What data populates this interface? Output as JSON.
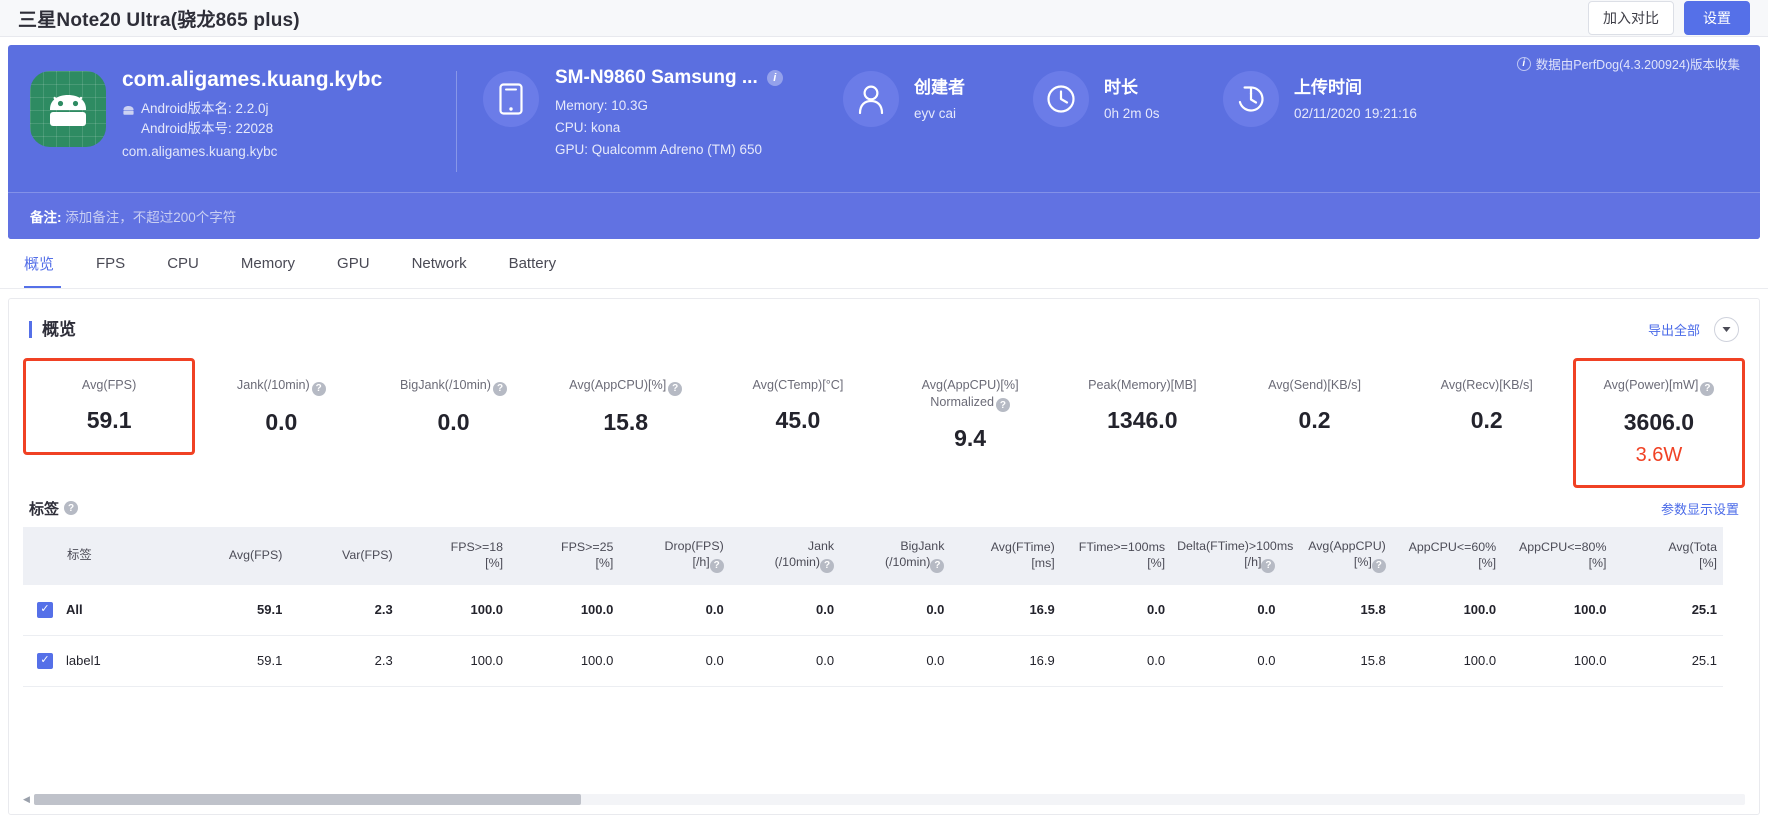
{
  "topbar": {
    "title": "三星Note20 Ultra(骁龙865 plus)",
    "compare_label": "加入对比",
    "settings_label": "设置"
  },
  "hero": {
    "collect_note": "数据由PerfDog(4.3.200924)版本收集",
    "app": {
      "name": "com.aligames.kuang.kybc",
      "version_name": "Android版本名: 2.2.0j",
      "version_code": "Android版本号: 22028",
      "package": "com.aligames.kuang.kybc"
    },
    "device": {
      "name": "SM-N9860 Samsung ...",
      "memory": "Memory: 10.3G",
      "cpu": "CPU: kona",
      "gpu": "GPU: Qualcomm Adreno (TM) 650"
    },
    "creator": {
      "title": "创建者",
      "value": "eyv cai"
    },
    "duration": {
      "title": "时长",
      "value": "0h 2m 0s"
    },
    "upload": {
      "title": "上传时间",
      "value": "02/11/2020 19:21:16"
    },
    "note": {
      "label": "备注:",
      "placeholder": "添加备注，不超过200个字符"
    }
  },
  "tabs": [
    {
      "label": "概览",
      "active": true
    },
    {
      "label": "FPS",
      "active": false
    },
    {
      "label": "CPU",
      "active": false
    },
    {
      "label": "Memory",
      "active": false
    },
    {
      "label": "GPU",
      "active": false
    },
    {
      "label": "Network",
      "active": false
    },
    {
      "label": "Battery",
      "active": false
    }
  ],
  "overview": {
    "section_title": "概览",
    "export_all_label": "导出全部",
    "metrics": [
      {
        "label": "Avg(FPS)",
        "value": "59.1",
        "help": false,
        "highlight": true,
        "sub": ""
      },
      {
        "label": "Jank(/10min)",
        "value": "0.0",
        "help": true,
        "highlight": false,
        "sub": ""
      },
      {
        "label": "BigJank(/10min)",
        "value": "0.0",
        "help": true,
        "highlight": false,
        "sub": ""
      },
      {
        "label": "Avg(AppCPU)[%]",
        "value": "15.8",
        "help": true,
        "highlight": false,
        "sub": ""
      },
      {
        "label": "Avg(CTemp)[°C]",
        "value": "45.0",
        "help": false,
        "highlight": false,
        "sub": ""
      },
      {
        "label": "Avg(AppCPU)[%]\nNormalized",
        "value": "9.4",
        "help": true,
        "highlight": false,
        "sub": ""
      },
      {
        "label": "Peak(Memory)[MB]",
        "value": "1346.0",
        "help": false,
        "highlight": false,
        "sub": ""
      },
      {
        "label": "Avg(Send)[KB/s]",
        "value": "0.2",
        "help": false,
        "highlight": false,
        "sub": ""
      },
      {
        "label": "Avg(Recv)[KB/s]",
        "value": "0.2",
        "help": false,
        "highlight": false,
        "sub": ""
      },
      {
        "label": "Avg(Power)[mW]",
        "value": "3606.0",
        "help": true,
        "highlight": true,
        "sub": "3.6W"
      }
    ]
  },
  "labels": {
    "title": "标签",
    "settings_link": "参数显示设置",
    "columns": [
      "标签",
      "Avg(FPS)",
      "Var(FPS)",
      "FPS>=18\n[%]",
      "FPS>=25\n[%]",
      "Drop(FPS)\n[/h]",
      "Jank\n(/10min)",
      "BigJank\n(/10min)",
      "Avg(FTime)\n[ms]",
      "FTime>=100ms\n[%]",
      "Delta(FTime)>100ms\n[/h]",
      "Avg(AppCPU)\n[%]",
      "AppCPU<=60%\n[%]",
      "AppCPU<=80%\n[%]",
      "Avg(Tota\n[%]"
    ],
    "column_help": [
      false,
      false,
      false,
      false,
      false,
      true,
      true,
      true,
      false,
      false,
      true,
      true,
      false,
      false,
      false
    ],
    "rows": [
      {
        "checked": true,
        "name": "All",
        "bold": true,
        "values": [
          "59.1",
          "2.3",
          "100.0",
          "100.0",
          "0.0",
          "0.0",
          "0.0",
          "16.9",
          "0.0",
          "0.0",
          "15.8",
          "100.0",
          "100.0",
          "25.1"
        ]
      },
      {
        "checked": true,
        "name": "label1",
        "bold": false,
        "values": [
          "59.1",
          "2.3",
          "100.0",
          "100.0",
          "0.0",
          "0.0",
          "0.0",
          "16.9",
          "0.0",
          "0.0",
          "15.8",
          "100.0",
          "100.0",
          "25.1"
        ]
      }
    ]
  },
  "colors": {
    "accent": "#5570e8",
    "hero": "#5b6fe0",
    "highlight": "#f04124",
    "app_icon": "#2e8b62"
  }
}
